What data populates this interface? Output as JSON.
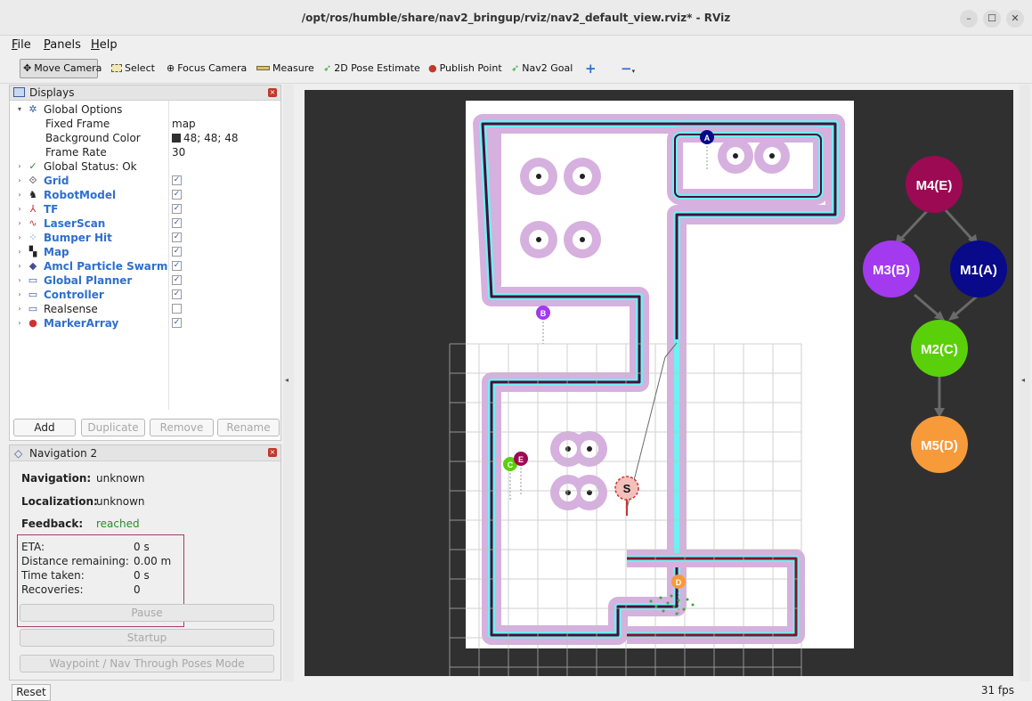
{
  "window": {
    "title": "/opt/ros/humble/share/nav2_bringup/rviz/nav2_default_view.rviz* - RViz"
  },
  "menu": [
    "File",
    "Panels",
    "Help"
  ],
  "toolbar": {
    "tools": [
      {
        "label": "Move Camera",
        "icon": "move-camera-icon"
      },
      {
        "label": "Select",
        "icon": "select-icon"
      },
      {
        "label": "Focus Camera",
        "icon": "focus-camera-icon"
      },
      {
        "label": "Measure",
        "icon": "measure-icon"
      },
      {
        "label": "2D Pose Estimate",
        "icon": "pose-estimate-icon"
      },
      {
        "label": "Publish Point",
        "icon": "publish-point-icon"
      },
      {
        "label": "Nav2 Goal",
        "icon": "nav2-goal-icon"
      }
    ]
  },
  "displays": {
    "title": "Displays",
    "global_options": "Global Options",
    "fixed_frame": {
      "label": "Fixed Frame",
      "value": "map"
    },
    "background_color": {
      "label": "Background Color",
      "value": "48; 48; 48"
    },
    "frame_rate": {
      "label": "Frame Rate",
      "value": "30"
    },
    "global_status": "Global Status: Ok",
    "items": [
      {
        "label": "Grid",
        "checked": true
      },
      {
        "label": "RobotModel",
        "checked": true
      },
      {
        "label": "TF",
        "checked": true
      },
      {
        "label": "LaserScan",
        "checked": true
      },
      {
        "label": "Bumper Hit",
        "checked": true
      },
      {
        "label": "Map",
        "checked": true
      },
      {
        "label": "Amcl Particle Swarm",
        "checked": true
      },
      {
        "label": "Global Planner",
        "checked": true
      },
      {
        "label": "Controller",
        "checked": true
      },
      {
        "label": "Realsense",
        "checked": false
      },
      {
        "label": "MarkerArray",
        "checked": true
      }
    ],
    "buttons": {
      "add": "Add",
      "duplicate": "Duplicate",
      "remove": "Remove",
      "rename": "Rename"
    }
  },
  "navigation": {
    "title": "Navigation 2",
    "navigation_label": "Navigation:",
    "navigation_value": "unknown",
    "localization_label": "Localization:",
    "localization_value": "unknown",
    "feedback_label": "Feedback:",
    "feedback_value": "reached",
    "eta_label": "ETA:",
    "eta_value": "0 s",
    "distance_label": "Distance remaining:",
    "distance_value": "0.00 m",
    "time_label": "Time taken:",
    "time_value": "0 s",
    "recoveries_label": "Recoveries:",
    "recoveries_value": "0",
    "pause": "Pause",
    "startup": "Startup",
    "waypoint_mode": "Waypoint / Nav Through Poses Mode"
  },
  "markers": {
    "A": "A",
    "B": "B",
    "C": "C",
    "D": "D",
    "E": "E",
    "S": "S"
  },
  "graph": {
    "nodes": {
      "m4": "M4(E)",
      "m3": "M3(B)",
      "m1": "M1(A)",
      "m2": "M2(C)",
      "m5": "M5(D)"
    },
    "colors": {
      "m4": "#9b0a52",
      "m3": "#a33af0",
      "m1": "#080a8a",
      "m2": "#5ad00a",
      "m5": "#f79a3a"
    }
  },
  "bottom": {
    "reset": "Reset",
    "fps": "31 fps"
  }
}
